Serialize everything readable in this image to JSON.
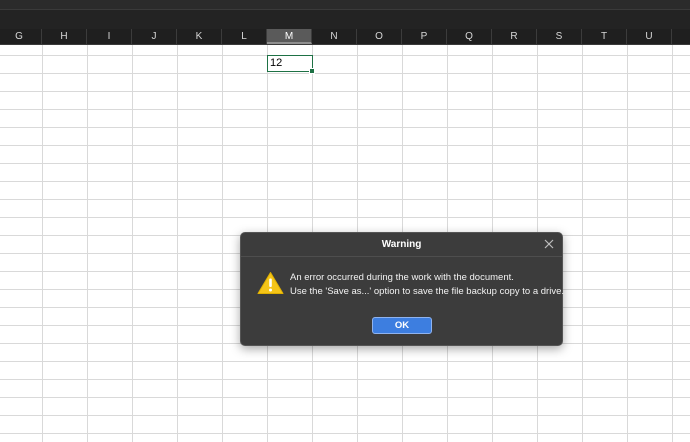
{
  "columns": [
    {
      "label": "G",
      "active": false
    },
    {
      "label": "H",
      "active": false
    },
    {
      "label": "I",
      "active": false
    },
    {
      "label": "J",
      "active": false
    },
    {
      "label": "K",
      "active": false
    },
    {
      "label": "L",
      "active": false
    },
    {
      "label": "M",
      "active": true
    },
    {
      "label": "N",
      "active": false
    },
    {
      "label": "O",
      "active": false
    },
    {
      "label": "P",
      "active": false
    },
    {
      "label": "Q",
      "active": false
    },
    {
      "label": "R",
      "active": false
    },
    {
      "label": "S",
      "active": false
    },
    {
      "label": "T",
      "active": false
    },
    {
      "label": "U",
      "active": false
    }
  ],
  "active_cell": {
    "value": "12"
  },
  "dialog": {
    "title": "Warning",
    "line1": "An error occurred during the work with the document.",
    "line2": "Use the 'Save as...' option to save the file backup copy to a drive.",
    "ok_label": "OK",
    "icon": "warning-triangle-icon"
  },
  "colors": {
    "accent": "#3d7ee0",
    "dialog_bg": "#3c3c3c",
    "warning": "#f5c518",
    "selection": "#1e7145"
  }
}
